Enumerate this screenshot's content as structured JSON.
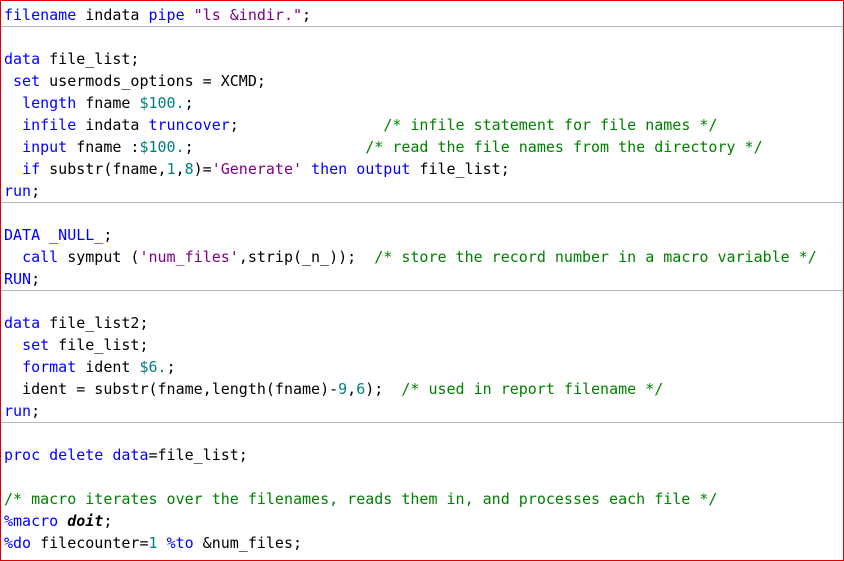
{
  "colors": {
    "keyword": "#0000ff",
    "string": "#800080",
    "comment": "#008000",
    "number": "#008080",
    "text": "#000000",
    "border": "#e00000",
    "separator": "#b8b8b8"
  },
  "lines": [
    {
      "sep": true,
      "tokens": [
        {
          "t": "kw",
          "v": "filename"
        },
        {
          "t": "plain",
          "v": " indata "
        },
        {
          "t": "kw",
          "v": "pipe"
        },
        {
          "t": "plain",
          "v": " "
        },
        {
          "t": "str",
          "v": "\"ls &indir.\""
        },
        {
          "t": "plain",
          "v": ";"
        }
      ]
    },
    {
      "tokens": [
        {
          "t": "plain",
          "v": " "
        }
      ]
    },
    {
      "tokens": [
        {
          "t": "kw",
          "v": "data"
        },
        {
          "t": "plain",
          "v": " file_list;"
        }
      ]
    },
    {
      "tokens": [
        {
          "t": "plain",
          "v": " "
        },
        {
          "t": "kw",
          "v": "set"
        },
        {
          "t": "plain",
          "v": " usermods_options = XCMD;"
        }
      ]
    },
    {
      "tokens": [
        {
          "t": "plain",
          "v": "  "
        },
        {
          "t": "kw",
          "v": "length"
        },
        {
          "t": "plain",
          "v": " fname "
        },
        {
          "t": "num",
          "v": "$100."
        },
        {
          "t": "plain",
          "v": ";"
        }
      ]
    },
    {
      "tokens": [
        {
          "t": "plain",
          "v": "  "
        },
        {
          "t": "kw",
          "v": "infile"
        },
        {
          "t": "plain",
          "v": " indata "
        },
        {
          "t": "kw",
          "v": "truncover"
        },
        {
          "t": "plain",
          "v": ";                "
        },
        {
          "t": "cmt",
          "v": "/* infile statement for file names */"
        }
      ]
    },
    {
      "tokens": [
        {
          "t": "plain",
          "v": "  "
        },
        {
          "t": "kw",
          "v": "input"
        },
        {
          "t": "plain",
          "v": " fname :"
        },
        {
          "t": "num",
          "v": "$100."
        },
        {
          "t": "plain",
          "v": ";                   "
        },
        {
          "t": "cmt",
          "v": "/* read the file names from the directory */"
        }
      ]
    },
    {
      "tokens": [
        {
          "t": "plain",
          "v": "  "
        },
        {
          "t": "kw",
          "v": "if"
        },
        {
          "t": "plain",
          "v": " substr(fname,"
        },
        {
          "t": "num",
          "v": "1"
        },
        {
          "t": "plain",
          "v": ","
        },
        {
          "t": "num",
          "v": "8"
        },
        {
          "t": "plain",
          "v": ")="
        },
        {
          "t": "str",
          "v": "'Generate'"
        },
        {
          "t": "plain",
          "v": " "
        },
        {
          "t": "kw",
          "v": "then"
        },
        {
          "t": "plain",
          "v": " "
        },
        {
          "t": "kw",
          "v": "output"
        },
        {
          "t": "plain",
          "v": " file_list;"
        }
      ]
    },
    {
      "sep": true,
      "tokens": [
        {
          "t": "kw",
          "v": "run"
        },
        {
          "t": "plain",
          "v": ";"
        }
      ]
    },
    {
      "tokens": [
        {
          "t": "plain",
          "v": " "
        }
      ]
    },
    {
      "tokens": [
        {
          "t": "kw",
          "v": "DATA"
        },
        {
          "t": "plain",
          "v": " "
        },
        {
          "t": "kw",
          "v": "_NULL_"
        },
        {
          "t": "plain",
          "v": ";"
        }
      ]
    },
    {
      "tokens": [
        {
          "t": "plain",
          "v": "  "
        },
        {
          "t": "kw",
          "v": "call"
        },
        {
          "t": "plain",
          "v": " symput ("
        },
        {
          "t": "str",
          "v": "'num_files'"
        },
        {
          "t": "plain",
          "v": ",strip(_n_));  "
        },
        {
          "t": "cmt",
          "v": "/* store the record number in a macro variable */"
        }
      ]
    },
    {
      "sep": true,
      "tokens": [
        {
          "t": "kw",
          "v": "RUN"
        },
        {
          "t": "plain",
          "v": ";"
        }
      ]
    },
    {
      "tokens": [
        {
          "t": "plain",
          "v": " "
        }
      ]
    },
    {
      "tokens": [
        {
          "t": "kw",
          "v": "data"
        },
        {
          "t": "plain",
          "v": " file_list2;"
        }
      ]
    },
    {
      "tokens": [
        {
          "t": "plain",
          "v": "  "
        },
        {
          "t": "kw",
          "v": "set"
        },
        {
          "t": "plain",
          "v": " file_list;"
        }
      ]
    },
    {
      "tokens": [
        {
          "t": "plain",
          "v": "  "
        },
        {
          "t": "kw",
          "v": "format"
        },
        {
          "t": "plain",
          "v": " ident "
        },
        {
          "t": "num",
          "v": "$6."
        },
        {
          "t": "plain",
          "v": ";"
        }
      ]
    },
    {
      "tokens": [
        {
          "t": "plain",
          "v": "  ident = substr(fname,length(fname)-"
        },
        {
          "t": "num",
          "v": "9"
        },
        {
          "t": "plain",
          "v": ","
        },
        {
          "t": "num",
          "v": "6"
        },
        {
          "t": "plain",
          "v": ");  "
        },
        {
          "t": "cmt",
          "v": "/* used in report filename */"
        }
      ]
    },
    {
      "sep": true,
      "tokens": [
        {
          "t": "kw",
          "v": "run"
        },
        {
          "t": "plain",
          "v": ";"
        }
      ]
    },
    {
      "tokens": [
        {
          "t": "plain",
          "v": " "
        }
      ]
    },
    {
      "tokens": [
        {
          "t": "kw",
          "v": "proc"
        },
        {
          "t": "plain",
          "v": " "
        },
        {
          "t": "kw",
          "v": "delete"
        },
        {
          "t": "plain",
          "v": " "
        },
        {
          "t": "kw",
          "v": "data"
        },
        {
          "t": "plain",
          "v": "=file_list;"
        }
      ]
    },
    {
      "tokens": [
        {
          "t": "plain",
          "v": " "
        }
      ]
    },
    {
      "tokens": [
        {
          "t": "cmt",
          "v": "/* macro iterates over the filenames, reads them in, and processes each file */"
        }
      ]
    },
    {
      "tokens": [
        {
          "t": "macro",
          "v": "%macro"
        },
        {
          "t": "plain",
          "v": " "
        },
        {
          "t": "mname",
          "v": "doit"
        },
        {
          "t": "plain",
          "v": ";"
        }
      ]
    },
    {
      "tokens": [
        {
          "t": "macro",
          "v": "%do"
        },
        {
          "t": "plain",
          "v": " filecounter="
        },
        {
          "t": "num",
          "v": "1"
        },
        {
          "t": "plain",
          "v": " "
        },
        {
          "t": "macro",
          "v": "%to"
        },
        {
          "t": "plain",
          "v": " &num_files;"
        }
      ]
    }
  ]
}
